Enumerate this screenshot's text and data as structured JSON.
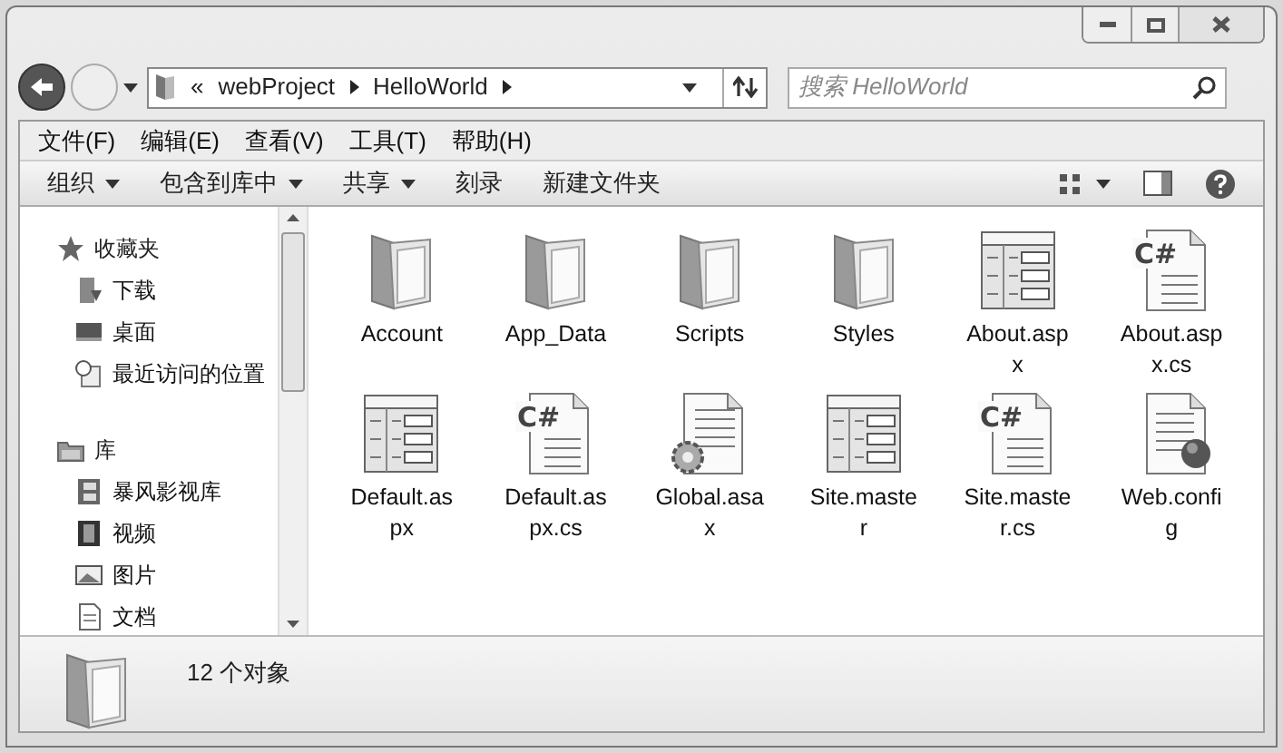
{
  "address": {
    "segments": [
      "«",
      "webProject",
      "HelloWorld"
    ]
  },
  "search": {
    "placeholder": "搜索 HelloWorld"
  },
  "menu": [
    "文件(F)",
    "编辑(E)",
    "查看(V)",
    "工具(T)",
    "帮助(H)"
  ],
  "toolbar": [
    {
      "label": "组织",
      "has_menu": true
    },
    {
      "label": "包含到库中",
      "has_menu": true
    },
    {
      "label": "共享",
      "has_menu": true
    },
    {
      "label": "刻录",
      "has_menu": false
    },
    {
      "label": "新建文件夹",
      "has_menu": false
    }
  ],
  "sidebar": [
    {
      "label": "收藏夹",
      "children": [
        {
          "label": "下载"
        },
        {
          "label": "桌面"
        },
        {
          "label": "最近访问的位置"
        }
      ]
    },
    {
      "label": "库",
      "children": [
        {
          "label": "暴风影视库"
        },
        {
          "label": "视频"
        },
        {
          "label": "图片"
        },
        {
          "label": "文档"
        }
      ]
    }
  ],
  "files": [
    {
      "name": "Account",
      "kind": "folder"
    },
    {
      "name": "App_Data",
      "kind": "folder"
    },
    {
      "name": "Scripts",
      "kind": "folder"
    },
    {
      "name": "Styles",
      "kind": "folder"
    },
    {
      "name": "About.aspx",
      "kind": "aspx"
    },
    {
      "name": "About.aspx.cs",
      "kind": "cs",
      "icon_text": "C#"
    },
    {
      "name": "Default.aspx",
      "kind": "aspx"
    },
    {
      "name": "Default.aspx.cs",
      "kind": "cs",
      "icon_text": "C#"
    },
    {
      "name": "Global.asax",
      "kind": "asax"
    },
    {
      "name": "Site.master",
      "kind": "aspx"
    },
    {
      "name": "Site.master.cs",
      "kind": "cs",
      "icon_text": "C#"
    },
    {
      "name": "Web.config",
      "kind": "config"
    }
  ],
  "status_bar": {
    "count": "12 个对象"
  }
}
